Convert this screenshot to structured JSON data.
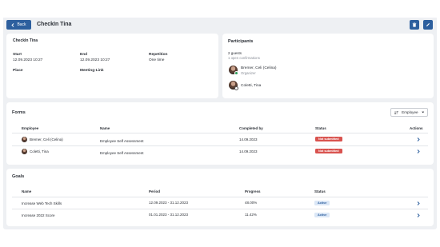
{
  "header": {
    "back_label": "Back",
    "title": "CheckIn Tina",
    "delete_icon": "trash-icon",
    "edit_icon": "pencil-icon"
  },
  "details": {
    "title": "CheckIn Tina",
    "start_label": "Start",
    "start_value": "12.09.2023 10:27",
    "end_label": "End",
    "end_value": "12.09.2023 10:27",
    "repetition_label": "Repetition",
    "repetition_value": "One time",
    "place_label": "Place",
    "meeting_link_label": "Meeting-Link"
  },
  "participants": {
    "title": "Participants",
    "guests_count": "2 guests",
    "open_confirmations": "1 open confirmations",
    "people": [
      {
        "name": "Bremer, Celi (Celina)",
        "role": "Organizer",
        "status": "confirmed"
      },
      {
        "name": "Coletti, Tina",
        "role": "",
        "status": "pending"
      }
    ]
  },
  "forms": {
    "title": "Forms",
    "filter_label": "Employee",
    "columns": [
      "Employee",
      "Name",
      "Completed by",
      "Status",
      "Actions"
    ],
    "rows": [
      {
        "employee": "Bremer, Celi (Celina)",
        "name": "Employee Self Assessment",
        "completed_by": "14.09.2023",
        "status": "Not submitted"
      },
      {
        "employee": "Coletti, Tina",
        "name": "Employee Self Assessment",
        "completed_by": "14.09.2023",
        "status": "Not submitted"
      }
    ]
  },
  "goals": {
    "title": "Goals",
    "columns": [
      "Name",
      "Period",
      "Progress",
      "Status"
    ],
    "rows": [
      {
        "name": "Increase Web Tech Skills",
        "period": "12.09.2023 - 31.12.2023",
        "progress": "48.00%",
        "status": "Active"
      },
      {
        "name": "Increase 2022 Score",
        "period": "01.01.2023 - 31.12.2023",
        "progress": "11.42%",
        "status": "Active"
      }
    ]
  },
  "colors": {
    "primary": "#2d5f9e",
    "danger": "#d9534f",
    "active_bg": "#dbe7f6",
    "background": "#eef0f3"
  }
}
